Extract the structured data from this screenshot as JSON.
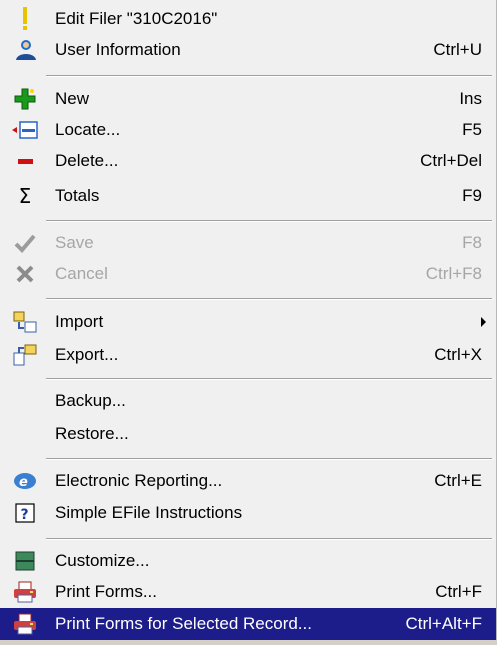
{
  "menu": {
    "items": [
      {
        "label": "Edit Filer \"310C2016\"",
        "shortcut": "",
        "icon": "exclamation-icon"
      },
      {
        "label": "User Information",
        "shortcut": "Ctrl+U",
        "icon": "user-icon"
      },
      {
        "label": "New",
        "shortcut": "Ins",
        "icon": "new-plus-icon"
      },
      {
        "label": "Locate...",
        "shortcut": "F5",
        "icon": "locate-icon"
      },
      {
        "label": "Delete...",
        "shortcut": "Ctrl+Del",
        "icon": "delete-minus-icon"
      },
      {
        "label": "Totals",
        "shortcut": "F9",
        "icon": "sigma-icon"
      },
      {
        "label": "Save",
        "shortcut": "F8",
        "icon": "checkmark-icon"
      },
      {
        "label": "Cancel",
        "shortcut": "Ctrl+F8",
        "icon": "x-icon"
      },
      {
        "label": "Import",
        "shortcut": "",
        "icon": "import-icon"
      },
      {
        "label": "Export...",
        "shortcut": "Ctrl+X",
        "icon": "export-icon"
      },
      {
        "label": "Backup...",
        "shortcut": "",
        "icon": ""
      },
      {
        "label": "Restore...",
        "shortcut": "",
        "icon": ""
      },
      {
        "label": "Electronic Reporting...",
        "shortcut": "Ctrl+E",
        "icon": "electronic-reporting-icon"
      },
      {
        "label": "Simple EFile Instructions",
        "shortcut": "",
        "icon": "help-question-icon"
      },
      {
        "label": "Customize...",
        "shortcut": "",
        "icon": "customize-icon"
      },
      {
        "label": "Print Forms...",
        "shortcut": "Ctrl+F",
        "icon": "printer-icon"
      },
      {
        "label": "Print Forms for Selected Record...",
        "shortcut": "Ctrl+Alt+F",
        "icon": "printer-icon"
      }
    ]
  },
  "colors": {
    "menu_bg": "#f0f0f0",
    "highlight_bg": "#1c1c8a",
    "disabled_text": "#a6a6a6"
  }
}
